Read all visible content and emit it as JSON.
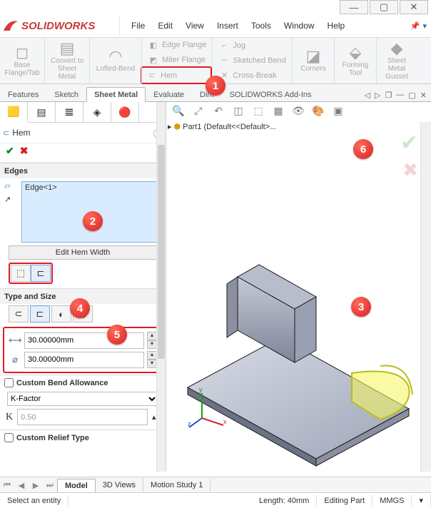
{
  "app_name": "SOLIDWORKS",
  "menu": [
    "File",
    "Edit",
    "View",
    "Insert",
    "Tools",
    "Window",
    "Help"
  ],
  "ribbon": {
    "big": [
      {
        "label": "Base\nFlange/Tab"
      },
      {
        "label": "Convert\nto Sheet\nMetal"
      },
      {
        "label": "Lofted-Bend"
      }
    ],
    "sub": [
      [
        "Edge Flange",
        "Jog"
      ],
      [
        "Miter Flange",
        "Sketched Bend"
      ],
      [
        "Hem",
        "Cross-Break"
      ]
    ],
    "corners": "Corners",
    "right": [
      {
        "label": "Forming\nTool"
      },
      {
        "label": "Sheet\nMetal\nGusset"
      }
    ]
  },
  "tabs": [
    "Features",
    "Sketch",
    "Sheet Metal",
    "Evaluate",
    "DimXpert",
    "SOLIDWORKS Add-Ins"
  ],
  "active_tab": 2,
  "feature": {
    "title": "Hem",
    "edges_hdr": "Edges",
    "edge": "Edge<1>",
    "edit_width": "Edit Hem Width",
    "type_hdr": "Type and Size",
    "len": "30.00000mm",
    "dia": "30.00000mm",
    "cba": "Custom Bend Allowance",
    "kfactor_opt": "K-Factor",
    "kval": "0.50",
    "crt": "Custom Relief Type"
  },
  "tree": "Part1 (Default<<Default>...",
  "bottom_tabs": [
    "Model",
    "3D Views",
    "Motion Study 1"
  ],
  "status": {
    "prompt": "Select an entity",
    "len": "Length: 40mm",
    "mode": "Editing Part",
    "units": "MMGS"
  }
}
